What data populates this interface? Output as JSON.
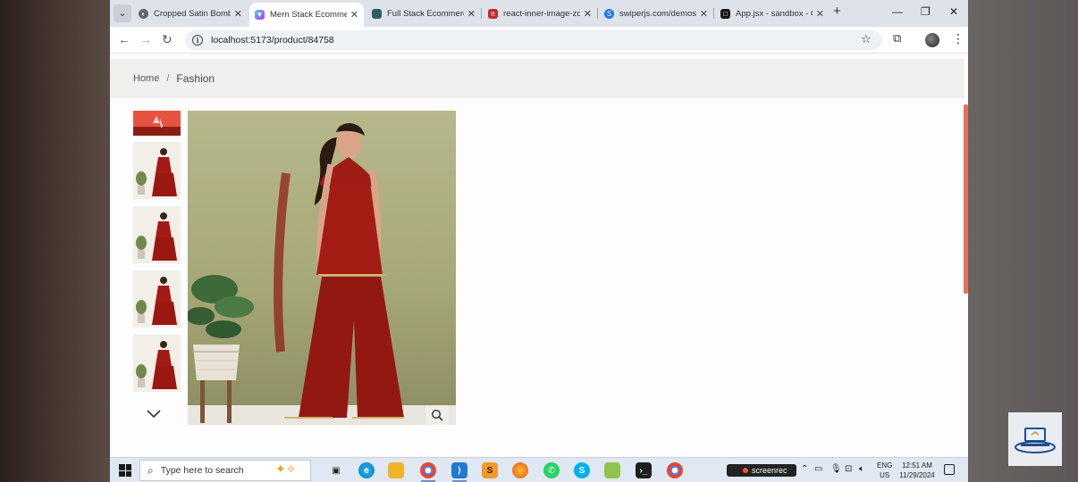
{
  "browser": {
    "tabs": [
      {
        "title": "Cropped Satin Bomb",
        "favicon_color": "#555555",
        "favicon": "circle-icon"
      },
      {
        "title": "Mern Stack Ecommer",
        "favicon_color": "#8b5cf6",
        "favicon": "vite-icon",
        "active": true
      },
      {
        "title": "Full Stack Ecommerc",
        "favicon_color": "#2f5d62",
        "favicon": "app-icon"
      },
      {
        "title": "react-inner-image-zo",
        "favicon_color": "#c22a2a",
        "favicon": "npm-icon"
      },
      {
        "title": "swiperjs.com/demos",
        "favicon_color": "#1877f2",
        "favicon": "swiper-icon"
      },
      {
        "title": "App.jsx - sandbox - C",
        "favicon_color": "#151515",
        "favicon": "codesandbox-icon"
      }
    ],
    "url": "localhost:5173/product/84758"
  },
  "page": {
    "breadcrumb": {
      "home": "Home",
      "separator": "/",
      "current": "Fashion"
    },
    "accent_color": "#e8533f"
  },
  "taskbar": {
    "search_placeholder": "Type here to search",
    "recorder_label": "screenrec",
    "lang_top": "ENG",
    "lang_bottom": "US",
    "time": "12:51 AM",
    "date": "11/29/2024"
  }
}
